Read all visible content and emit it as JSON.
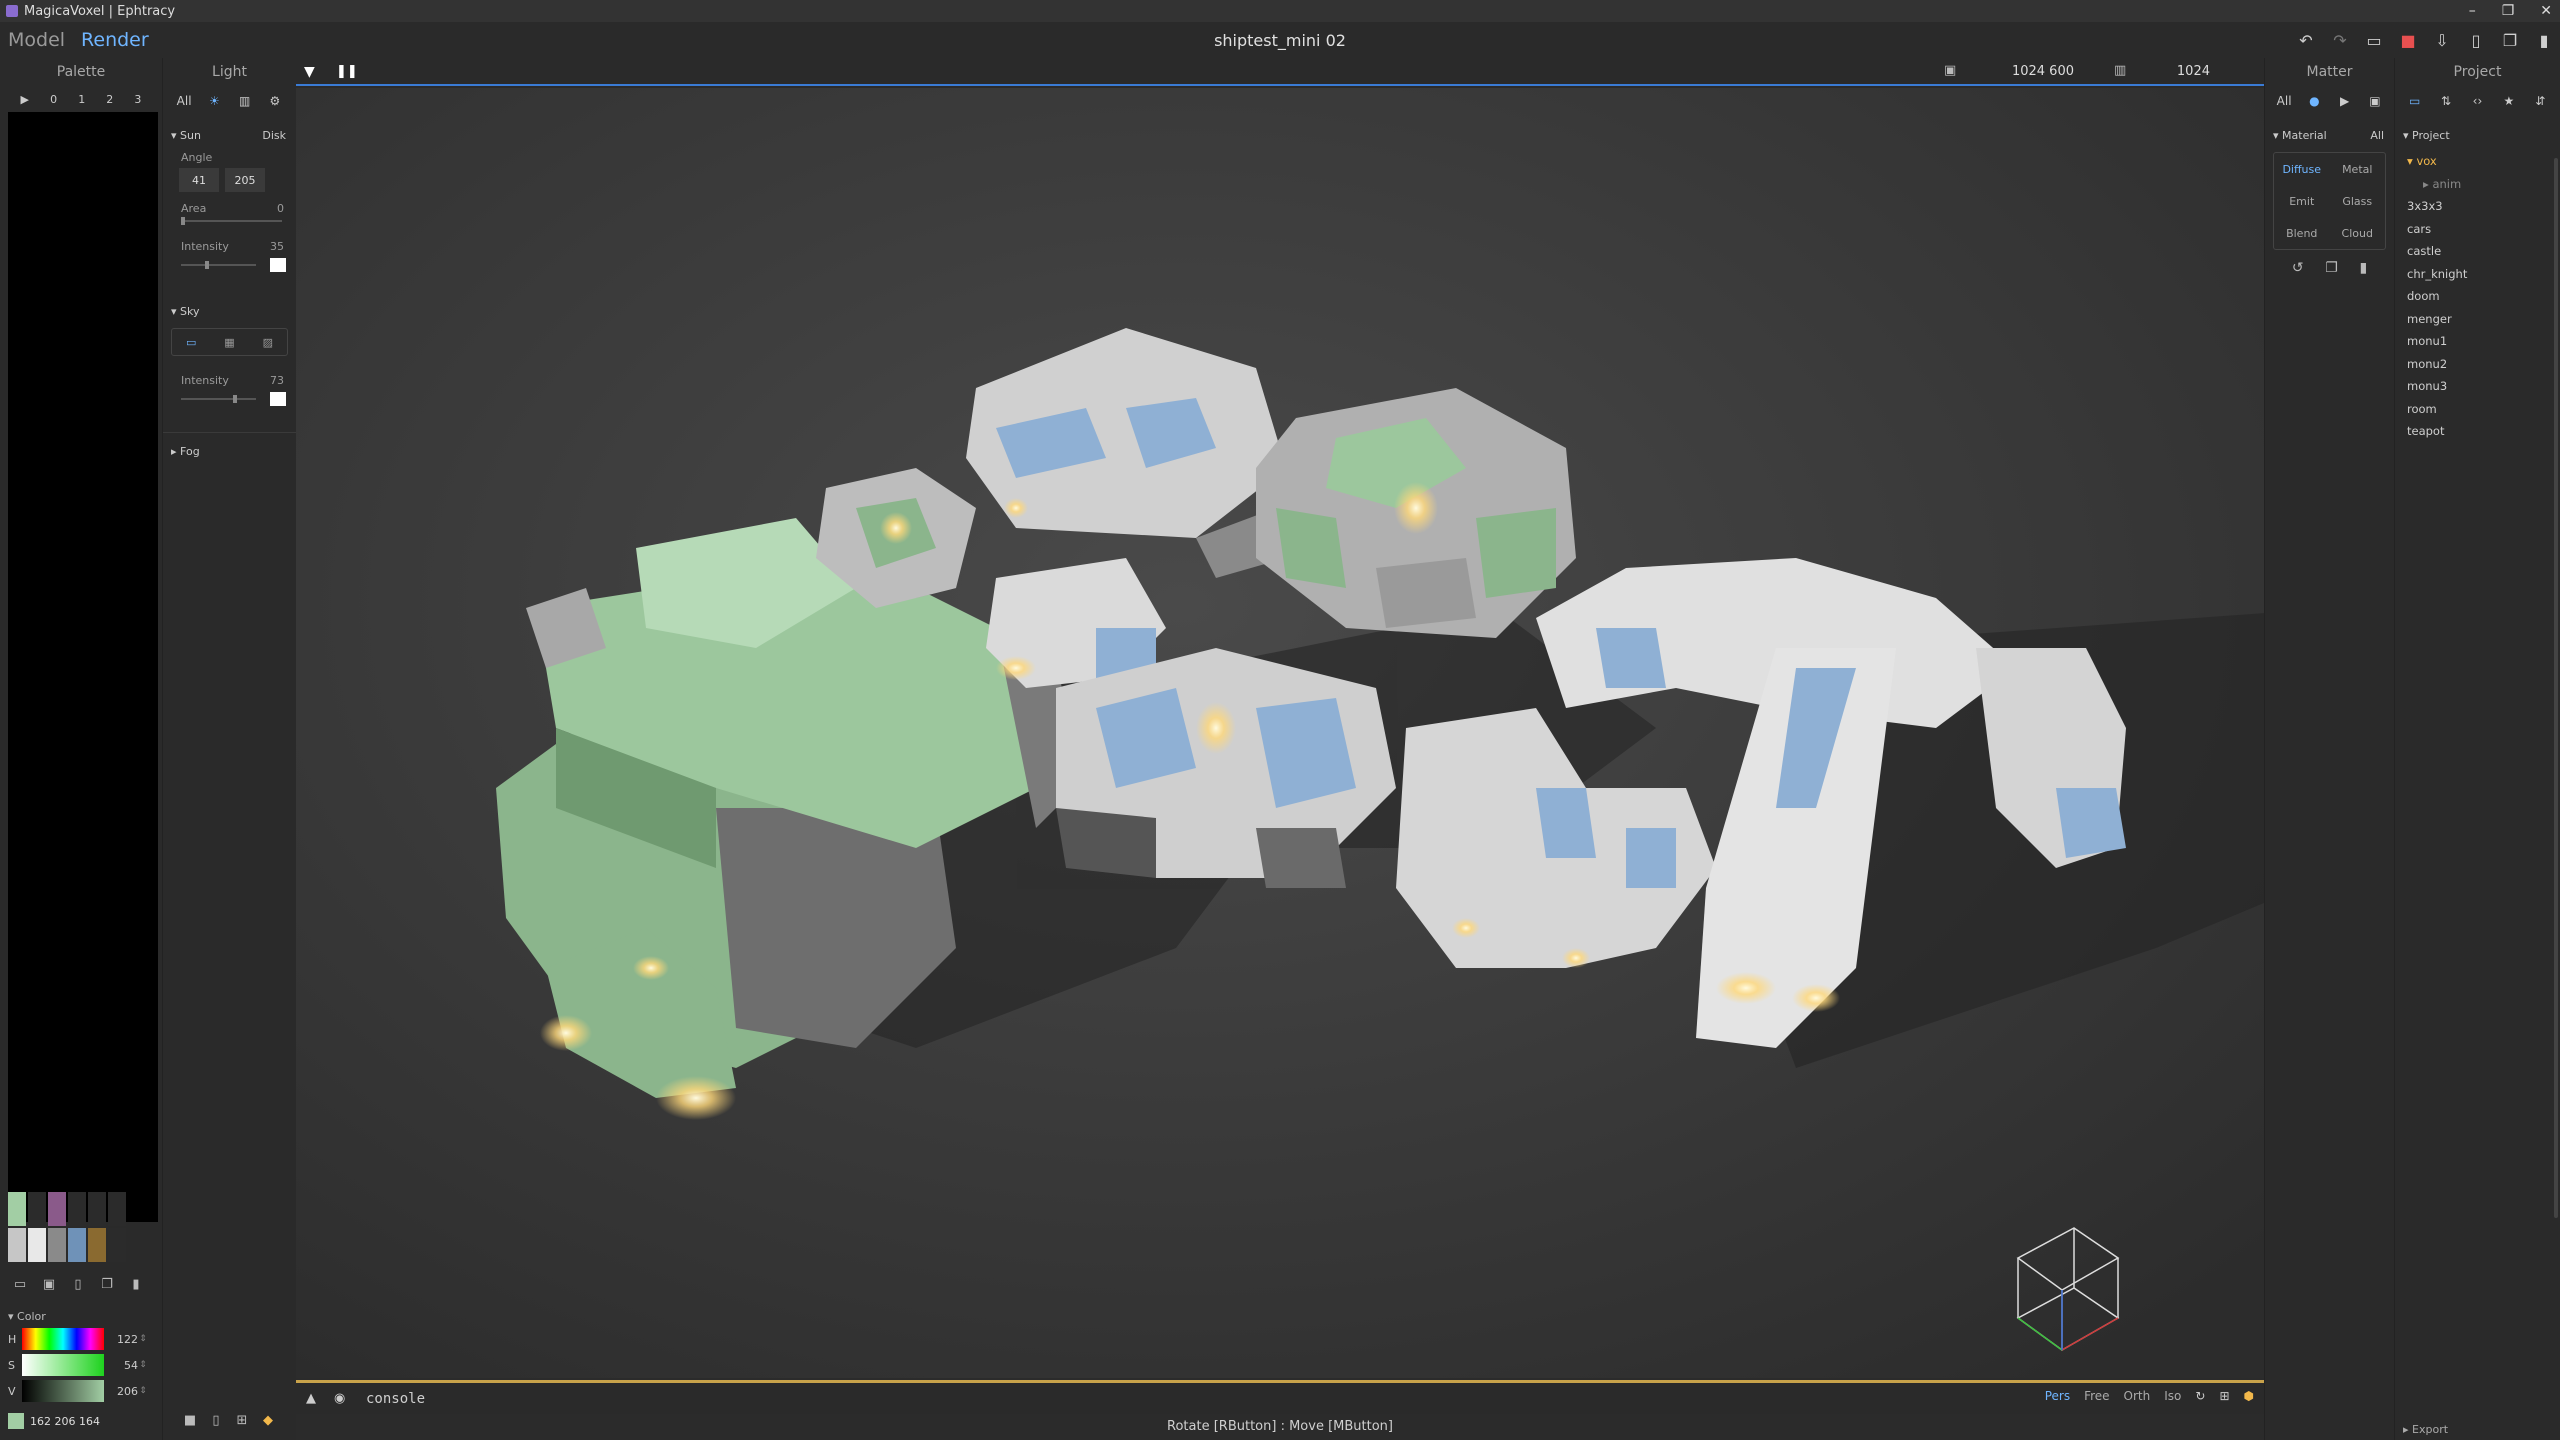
{
  "window": {
    "title": "MagicaVoxel | Ephtracy",
    "controls": [
      "–",
      "❐",
      "✕"
    ]
  },
  "menubar": {
    "model_tab": "Model",
    "render_tab": "Render",
    "document_title": "shiptest_mini 02"
  },
  "palette": {
    "title": "Palette",
    "page_numbers": [
      "▶",
      "0",
      "1",
      "2",
      "3"
    ],
    "swatch_colors": [
      "#a2cea4",
      "#2b2b2b",
      "#8a5a8a",
      "#2b2b2b",
      "#2b2b2b",
      "#2b2b2b",
      "#c6c6c6",
      "#e8e8e8",
      "#8a8a8a",
      "#6f92b8",
      "#8a6a30",
      "#2b2b2b"
    ],
    "color_section": "Color",
    "hsv": [
      {
        "key": "H",
        "value": "122"
      },
      {
        "key": "S",
        "value": "54"
      },
      {
        "key": "V",
        "value": "206"
      }
    ],
    "rgb": "162  206  164"
  },
  "light": {
    "title": "Light",
    "filter_all": "All",
    "sun": {
      "label": "Sun",
      "mode": "Disk",
      "angle_label": "Angle",
      "angle_1": "41",
      "angle_2": "205",
      "area_label": "Area",
      "area_value": "0",
      "intensity_label": "Intensity",
      "intensity_value": "35"
    },
    "sky": {
      "label": "Sky",
      "intensity_label": "Intensity",
      "intensity_value": "73"
    },
    "fog": {
      "label": "Fog"
    }
  },
  "viewport": {
    "resolution": "1024  600",
    "samples": "1024",
    "console_label": "console",
    "view_modes": [
      "Pers",
      "Free",
      "Orth",
      "Iso"
    ],
    "status": "Rotate [RButton] : Move [MButton]"
  },
  "matter": {
    "title": "Matter",
    "filter_all": "All",
    "material_label": "Material",
    "material_scope": "All",
    "materials": [
      "Diffuse",
      "Metal",
      "Emit",
      "Glass",
      "Blend",
      "Cloud"
    ]
  },
  "project": {
    "title": "Project",
    "section_label": "Project",
    "folder": "vox",
    "subfolder": "anim",
    "items": [
      "3x3x3",
      "cars",
      "castle",
      "chr_knight",
      "doom",
      "menger",
      "monu1",
      "monu2",
      "monu3",
      "room",
      "teapot"
    ],
    "export_label": "Export"
  }
}
